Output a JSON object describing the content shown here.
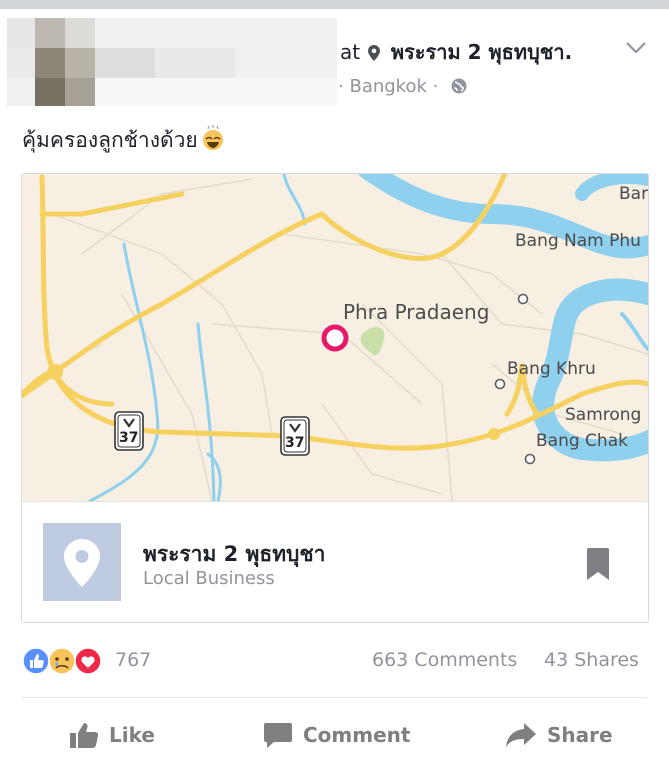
{
  "post": {
    "header_partial": "at",
    "location": "พระราม 2 พุธทบุชา.",
    "city": "Bangkok",
    "separator": "·",
    "text": "คุ้มครองลูกช้างด้วย"
  },
  "map": {
    "labels": {
      "phra_pradaeng": "Phra Pradaeng",
      "bang_nam_phu": "Bang Nam Phu",
      "bang_khru": "Bang Khru",
      "samrong": "Samrong",
      "bang_chak": "Bang Chak",
      "bar": "Bar"
    },
    "route_shield": "37"
  },
  "place": {
    "name": "พระราม 2 พุธทบุชา",
    "category": "Local Business"
  },
  "stats": {
    "reactions": "767",
    "comments": "663 Comments",
    "shares": "43 Shares"
  },
  "actions": {
    "like": "Like",
    "comment": "Comment",
    "share": "Share"
  },
  "colors": {
    "fb_blue": "#4267b2",
    "like_blue": "#5890ff",
    "love_red": "#f0284a",
    "sad_yellow": "#f7c35a",
    "map_pin": "#e8196b",
    "road_yellow": "#f7d160",
    "water_blue": "#8fd0ee"
  },
  "icons": [
    "location-pin-icon",
    "chevron-down-icon",
    "globe-icon",
    "grinning-sweat-emoji",
    "map-pin-icon",
    "place-placeholder-icon",
    "bookmark-icon",
    "like-reaction-icon",
    "sad-reaction-icon",
    "love-reaction-icon",
    "thumbs-up-icon",
    "comment-bubble-icon",
    "share-arrow-icon"
  ]
}
